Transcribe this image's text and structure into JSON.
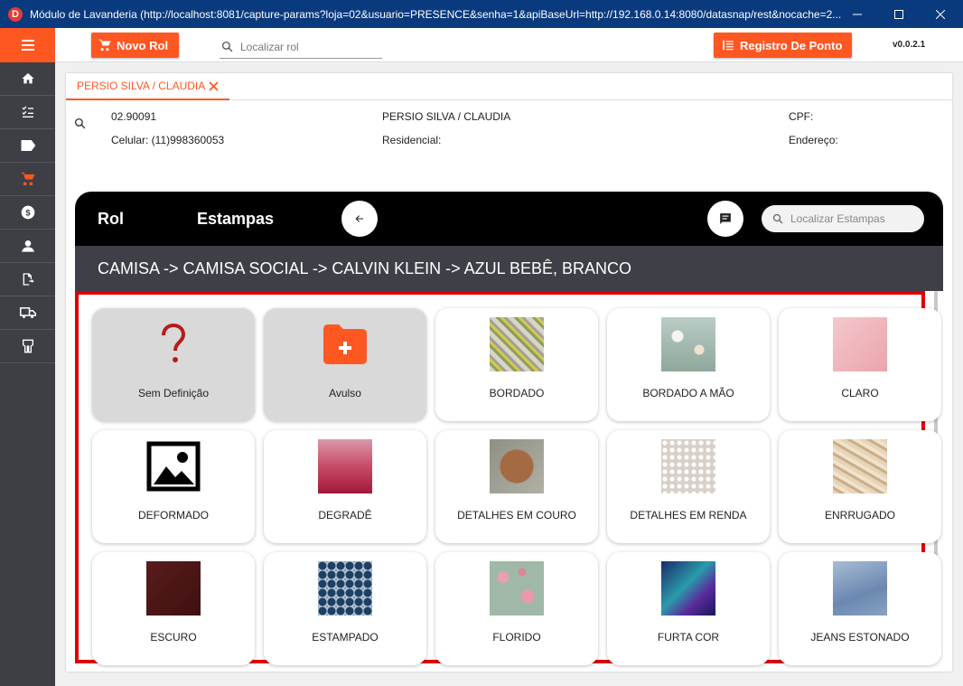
{
  "window": {
    "app_icon_letter": "D",
    "title": "Módulo de Lavanderia (http://localhost:8081/capture-params?loja=02&usuario=PRESENCE&senha=1&apiBaseUrl=http://192.168.0.14:8080/datasnap/rest&nocache=2..."
  },
  "header": {
    "novo_rol_label": "Novo Rol",
    "search_placeholder": "Localizar rol",
    "registro_ponto_label": "Registro De Ponto",
    "version": "v0.0.2.1"
  },
  "sidebar": {
    "items": [
      "home-icon",
      "checklist-icon",
      "label-icon",
      "cart-icon",
      "money-icon",
      "person-icon",
      "export-icon",
      "truck-icon",
      "hanger-icon"
    ]
  },
  "tab": {
    "label": "PERSIO SILVA / CLAUDIA"
  },
  "customer": {
    "code": "02.90091",
    "name": "PERSIO SILVA / CLAUDIA",
    "cpf_label": "CPF:",
    "celular": "Celular: (11)998360053",
    "residencial": "Residencial:",
    "endereco": "Endereço:"
  },
  "panel": {
    "rol_label": "Rol",
    "title": "Estampas",
    "search_placeholder": "Localizar Estampas",
    "breadcrumb": "CAMISA -> CAMISA SOCIAL -> CALVIN KLEIN -> AZUL BEBÊ, BRANCO"
  },
  "estampas": [
    {
      "label": "Sem Definição",
      "icon": "question-icon"
    },
    {
      "label": "Avulso",
      "icon": "folder-add-icon"
    },
    {
      "label": "BORDADO",
      "icon": "bordado-image"
    },
    {
      "label": "BORDADO A MÃO",
      "icon": "bordado-mao-image"
    },
    {
      "label": "CLARO",
      "icon": "claro-image"
    },
    {
      "label": "DEFORMADO",
      "icon": "image-placeholder-icon"
    },
    {
      "label": "DEGRADÊ",
      "icon": "degrade-image"
    },
    {
      "label": "DETALHES EM COURO",
      "icon": "couro-image"
    },
    {
      "label": "DETALHES EM RENDA",
      "icon": "renda-image"
    },
    {
      "label": "ENRRUGADO",
      "icon": "enrrugado-image"
    },
    {
      "label": "ESCURO",
      "icon": "escuro-image"
    },
    {
      "label": "ESTAMPADO",
      "icon": "estampado-image"
    },
    {
      "label": "FLORIDO",
      "icon": "florido-image"
    },
    {
      "label": "FURTA COR",
      "icon": "furta-cor-image"
    },
    {
      "label": "JEANS ESTONADO",
      "icon": "jeans-image"
    }
  ],
  "colors": {
    "accent": "#ff5722",
    "titlebar": "#0a3a7e",
    "sidebar": "#3e3f45",
    "highlight_frame": "#e00000"
  }
}
